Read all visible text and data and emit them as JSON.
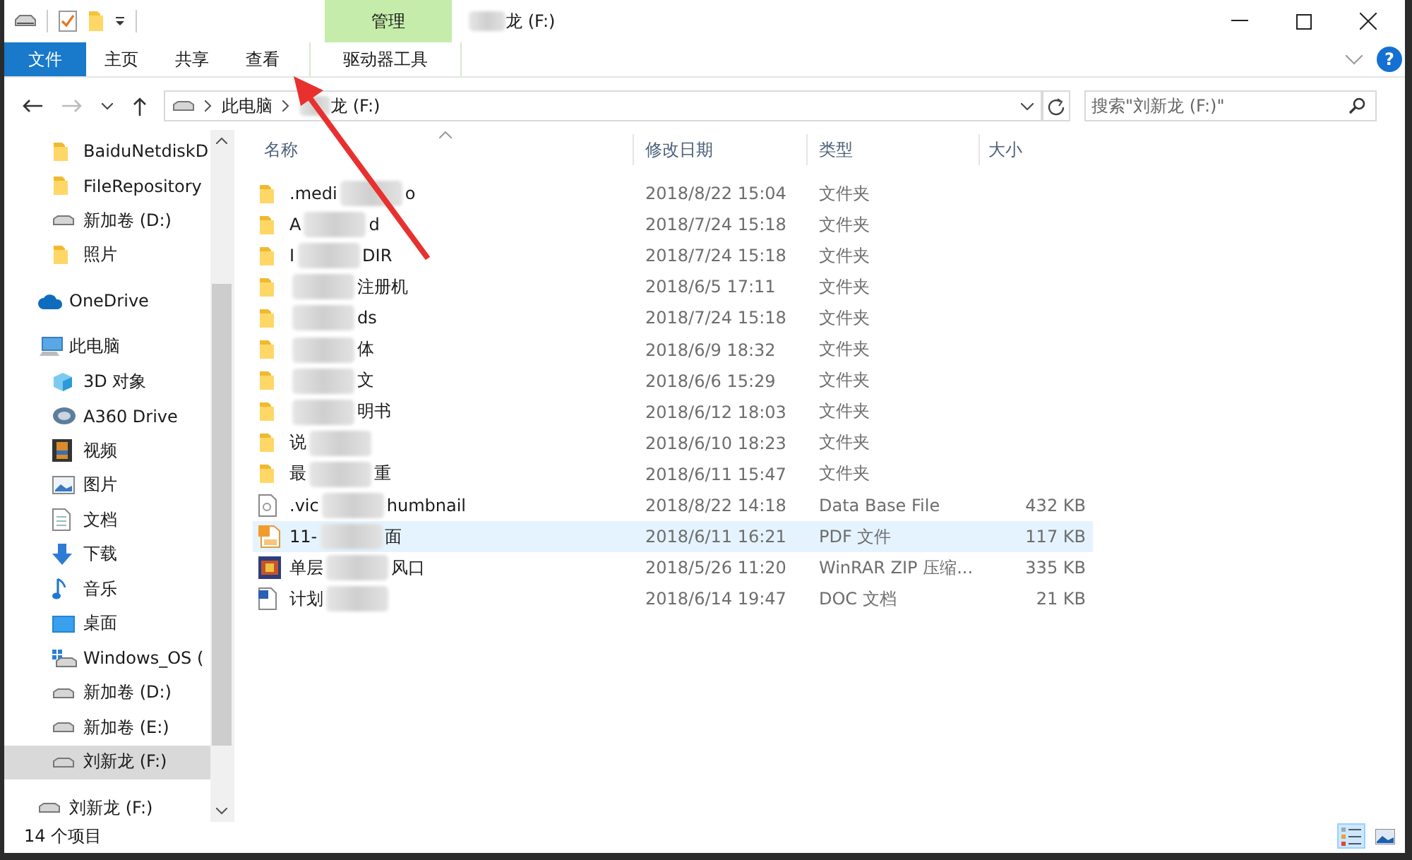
{
  "window": {
    "title": "龙 (F:)"
  },
  "ribbon": {
    "context_group": "管理",
    "tabs": [
      {
        "label": "文件",
        "kind": "file",
        "selected": false
      },
      {
        "label": "主页",
        "kind": "normal",
        "selected": false
      },
      {
        "label": "共享",
        "kind": "normal",
        "selected": false
      },
      {
        "label": "查看",
        "kind": "normal",
        "selected": false
      },
      {
        "label": "驱动器工具",
        "kind": "context",
        "selected": false
      }
    ],
    "help": "?"
  },
  "address": {
    "crumbs": [
      "此电脑",
      "龙 (F:)"
    ]
  },
  "search": {
    "placeholder": "搜索\"刘新龙 (F:)\""
  },
  "sidebar": {
    "quick_access_items": [
      {
        "label": "BaiduNetdiskD",
        "kind": "folder",
        "selected": false
      },
      {
        "label": "FileRepository",
        "kind": "folder",
        "selected": false
      },
      {
        "label": "新加卷 (D:)",
        "kind": "drive",
        "selected": false
      },
      {
        "label": "照片",
        "kind": "folder",
        "selected": false
      }
    ],
    "items": [
      {
        "label": "OneDrive",
        "kind": "cloud",
        "selected": false
      },
      {
        "label": "此电脑",
        "kind": "pc",
        "selected": false,
        "children": [
          {
            "label": "3D 对象",
            "kind": "cube",
            "selected": false
          },
          {
            "label": "A360 Drive",
            "kind": "a360",
            "selected": false
          },
          {
            "label": "视频",
            "kind": "video",
            "selected": false
          },
          {
            "label": "图片",
            "kind": "picture",
            "selected": false
          },
          {
            "label": "文档",
            "kind": "doc",
            "selected": false
          },
          {
            "label": "下载",
            "kind": "download",
            "selected": false
          },
          {
            "label": "音乐",
            "kind": "music",
            "selected": false
          },
          {
            "label": "桌面",
            "kind": "desktop",
            "selected": false
          },
          {
            "label": "Windows_OS (",
            "kind": "windrive",
            "selected": false
          },
          {
            "label": "新加卷 (D:)",
            "kind": "drive",
            "selected": false
          },
          {
            "label": "新加卷 (E:)",
            "kind": "drive",
            "selected": false
          },
          {
            "label": "刘新龙 (F:)",
            "kind": "drive",
            "selected": true
          }
        ]
      },
      {
        "label": "刘新龙 (F:)",
        "kind": "drive",
        "selected": false
      }
    ]
  },
  "table": {
    "columns": [
      "名称",
      "修改日期",
      "类型",
      "大小"
    ],
    "rows": [
      {
        "name_start": ".medi",
        "name_end": "o",
        "date": "2018/8/22 15:04",
        "type": "文件夹",
        "kind": "folder",
        "selected": false
      },
      {
        "name_start": "A",
        "name_end": "d",
        "date": "2018/7/24 15:18",
        "type": "文件夹",
        "kind": "folder",
        "selected": false
      },
      {
        "name_start": "I",
        "name_end": "DIR",
        "date": "2018/7/24 15:18",
        "type": "文件夹",
        "kind": "folder",
        "selected": false
      },
      {
        "name_end": "注册机",
        "date": "2018/6/5 17:11",
        "type": "文件夹",
        "kind": "folder",
        "selected": false
      },
      {
        "name_end": "ds",
        "date": "2018/7/24 15:18",
        "type": "文件夹",
        "kind": "folder",
        "selected": false
      },
      {
        "name_end": "体",
        "date": "2018/6/9 18:32",
        "type": "文件夹",
        "kind": "folder",
        "selected": false
      },
      {
        "name_end": "文",
        "date": "2018/6/6 15:29",
        "type": "文件夹",
        "kind": "folder",
        "selected": false
      },
      {
        "name_end": "明书",
        "date": "2018/6/12 18:03",
        "type": "文件夹",
        "kind": "folder",
        "selected": false
      },
      {
        "name_start": "说",
        "date": "2018/6/10 18:23",
        "type": "文件夹",
        "kind": "folder",
        "selected": false
      },
      {
        "name_start": "最",
        "name_end": "重",
        "date": "2018/6/11 15:47",
        "type": "文件夹",
        "kind": "folder",
        "selected": false
      },
      {
        "name_start": ".vic",
        "name_end": "humbnail",
        "date": "2018/8/22 14:18",
        "type": "Data Base File",
        "size": "432 KB",
        "kind": "db",
        "selected": false
      },
      {
        "name_start": "11-",
        "name_end": "面",
        "date": "2018/6/11 16:21",
        "type": "PDF 文件",
        "size": "117 KB",
        "kind": "pdf",
        "selected": true
      },
      {
        "name_start": "单层",
        "name_end": "风口",
        "date": "2018/5/26 11:20",
        "type": "WinRAR ZIP 压缩...",
        "size": "335 KB",
        "kind": "rar",
        "selected": false
      },
      {
        "name_start": "计划",
        "date": "2018/6/14 19:47",
        "type": "DOC 文档",
        "size": "21 KB",
        "kind": "docfile",
        "selected": false
      }
    ]
  },
  "status_bar": {
    "count": "14 个项目",
    "views": [
      {
        "kind": "details",
        "selected": true
      },
      {
        "kind": "thumbnails",
        "selected": false
      }
    ]
  }
}
